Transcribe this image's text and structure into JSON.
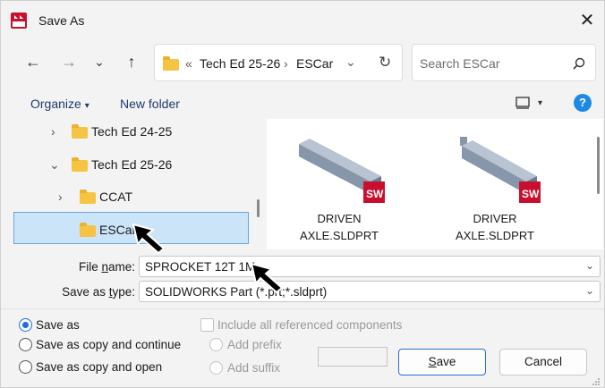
{
  "window": {
    "title": "Save As",
    "close": "✕"
  },
  "nav": {
    "back": "←",
    "forward": "→",
    "recent": "⌄",
    "up": "↑",
    "breadcrumb_sep_start": "«",
    "path": [
      "Tech Ed 25-26",
      "ESCar"
    ],
    "path_sep": "›",
    "dropdown": "⌄",
    "refresh": "↻"
  },
  "search": {
    "placeholder": "Search ESCar"
  },
  "commands": {
    "organize": "Organize",
    "organize_caret": "▾",
    "new_folder": "New folder",
    "view_caret": "▾",
    "help": "?"
  },
  "tree": [
    {
      "label": "Tech Ed 24-25",
      "chevron": "›"
    },
    {
      "label": "Tech Ed 25-26",
      "chevron": "⌄"
    },
    {
      "label": "CCAT",
      "chevron": "›"
    },
    {
      "label": "ESCar",
      "chevron": ""
    }
  ],
  "files": [
    {
      "name_line1": "DRIVEN",
      "name_line2": "AXLE.SLDPRT"
    },
    {
      "name_line1": "DRIVER",
      "name_line2": "AXLE.SLDPRT"
    }
  ],
  "form": {
    "file_name_label_pre": "File ",
    "file_name_label_u": "n",
    "file_name_label_post": "ame:",
    "file_name_value": "SPROCKET 12T 1M",
    "save_type_label_pre": "Save as ",
    "save_type_label_u": "t",
    "save_type_label_post": "ype:",
    "save_type_value": "SOLIDWORKS Part (*.prt;*.sldprt)",
    "arrow": "⌄"
  },
  "options": {
    "save_as": "Save as",
    "save_copy_continue": "Save as copy and continue",
    "save_copy_open": "Save as copy and open",
    "include_refs": "Include all referenced components",
    "add_prefix": "Add prefix",
    "add_suffix": "Add suffix"
  },
  "buttons": {
    "save_u": "S",
    "save_rest": "ave",
    "cancel": "Cancel"
  },
  "colors": {
    "accent": "#1e6fd9",
    "selection": "#cce4f7",
    "folder": "#f6c343"
  }
}
